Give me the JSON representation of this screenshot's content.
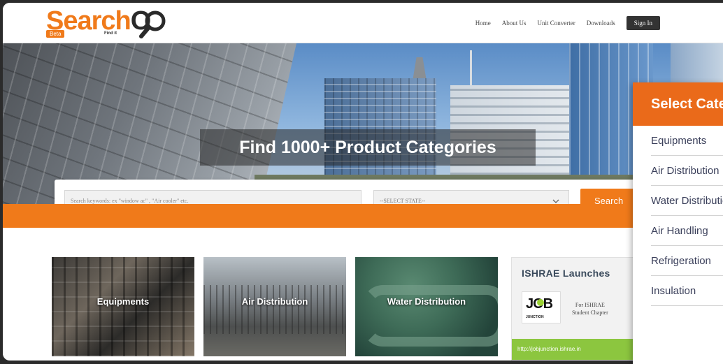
{
  "brand": {
    "logo_search": "Search",
    "logo_o": "O",
    "beta_label": "Beta",
    "tagline": "Find it"
  },
  "nav": {
    "items": [
      "Home",
      "About Us",
      "Unit Converter",
      "Downloads"
    ],
    "signin_label": "Sign In"
  },
  "hero": {
    "title": "Find 1000+ Product Categories"
  },
  "search": {
    "placeholder": "Search keywords: ex \"window ac\" , \"Air cooler\" etc.",
    "state_placeholder": "--SELECT STATE--",
    "button_label": "Search"
  },
  "categories": {
    "tiles": [
      "Equipments",
      "Air Distribution",
      "Water Distribution"
    ]
  },
  "promo": {
    "title": "ISHRAE Launches",
    "logo_text": "JOB",
    "logo_sub": "JUNCTION",
    "line1": "For ISHRAE",
    "line2": "Student Chapter",
    "link": "http://jobjunction.ishrae.in"
  },
  "dropdown": {
    "title": "Select Category",
    "items": [
      "Equipments",
      "Air Distribution",
      "Water Distribution",
      "Air Handling",
      "Refrigeration",
      "Insulation"
    ]
  },
  "colors": {
    "brand_orange": "#f07a1a",
    "promo_green": "#8cc63f",
    "dark": "#333333"
  }
}
